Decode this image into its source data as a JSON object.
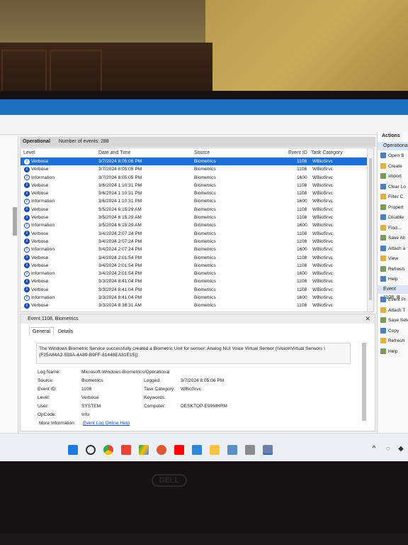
{
  "header": {
    "title": "Operational",
    "event_count": "Number of events: 288"
  },
  "columns": {
    "level": "Level",
    "date": "Date and Time",
    "source": "Source",
    "event_id": "Event ID",
    "task": "Task Category"
  },
  "rows": [
    {
      "level": "Verbose",
      "kind": "verbose",
      "date": "3/7/2024 8:05:06 PM",
      "source": "Biometrics",
      "id": "1108",
      "task": "WBioSrvc"
    },
    {
      "level": "Verbose",
      "kind": "verbose",
      "date": "3/7/2024 8:05:05 PM",
      "source": "Biometrics",
      "id": "1108",
      "task": "WBioSrvc"
    },
    {
      "level": "Information",
      "kind": "info",
      "date": "3/7/2024 8:05:05 PM",
      "source": "Biometrics",
      "id": "1600",
      "task": "WBioSrvc"
    },
    {
      "level": "Verbose",
      "kind": "verbose",
      "date": "3/6/2024 1:10:31 PM",
      "source": "Biometrics",
      "id": "1108",
      "task": "WBioSrvc"
    },
    {
      "level": "Verbose",
      "kind": "verbose",
      "date": "3/6/2024 1:10:31 PM",
      "source": "Biometrics",
      "id": "1108",
      "task": "WBioSrvc"
    },
    {
      "level": "Information",
      "kind": "info",
      "date": "3/6/2024 1:10:31 PM",
      "source": "Biometrics",
      "id": "1600",
      "task": "WBioSrvc"
    },
    {
      "level": "Verbose",
      "kind": "verbose",
      "date": "3/5/2024 6:15:29 AM",
      "source": "Biometrics",
      "id": "1108",
      "task": "WBioSrvc"
    },
    {
      "level": "Verbose",
      "kind": "verbose",
      "date": "3/5/2024 6:15:29 AM",
      "source": "Biometrics",
      "id": "1108",
      "task": "WBioSrvc"
    },
    {
      "level": "Information",
      "kind": "info",
      "date": "3/5/2024 6:15:29 AM",
      "source": "Biometrics",
      "id": "1600",
      "task": "WBioSrvc"
    },
    {
      "level": "Verbose",
      "kind": "verbose",
      "date": "3/4/2024 2:07:24 PM",
      "source": "Biometrics",
      "id": "1108",
      "task": "WBioSrvc"
    },
    {
      "level": "Verbose",
      "kind": "verbose",
      "date": "3/4/2024 2:07:24 PM",
      "source": "Biometrics",
      "id": "1108",
      "task": "WBioSrvc"
    },
    {
      "level": "Information",
      "kind": "info",
      "date": "3/4/2024 2:07:24 PM",
      "source": "Biometrics",
      "id": "1600",
      "task": "WBioSrvc"
    },
    {
      "level": "Verbose",
      "kind": "verbose",
      "date": "3/4/2024 2:01:54 PM",
      "source": "Biometrics",
      "id": "1108",
      "task": "WBioSrvc"
    },
    {
      "level": "Verbose",
      "kind": "verbose",
      "date": "3/4/2024 2:01:54 PM",
      "source": "Biometrics",
      "id": "1108",
      "task": "WBioSrvc"
    },
    {
      "level": "Information",
      "kind": "info",
      "date": "3/4/2024 2:01:54 PM",
      "source": "Biometrics",
      "id": "1600",
      "task": "WBioSrvc"
    },
    {
      "level": "Verbose",
      "kind": "verbose",
      "date": "3/3/2024 8:41:04 PM",
      "source": "Biometrics",
      "id": "1108",
      "task": "WBioSrvc"
    },
    {
      "level": "Verbose",
      "kind": "verbose",
      "date": "3/3/2024 8:41:04 PM",
      "source": "Biometrics",
      "id": "1108",
      "task": "WBioSrvc"
    },
    {
      "level": "Information",
      "kind": "info",
      "date": "3/3/2024 8:41:04 PM",
      "source": "Biometrics",
      "id": "1600",
      "task": "WBioSrvc"
    },
    {
      "level": "Verbose",
      "kind": "verbose",
      "date": "3/3/2024 8:38:31 AM",
      "source": "Biometrics",
      "id": "1108",
      "task": "WBioSrvc"
    }
  ],
  "detail": {
    "title": "Event 1108, Biometrics",
    "tab_general": "General",
    "tab_details": "Details",
    "description": "The Windows Biometric Service successfully created a Biometric Unit for sensor: Analog NUI Voice Virtual Sensor (\\Voice\\Virtual Sensors \\{F25A84A2-593A-4A89-B9FF-81448EA81E15})",
    "labels": {
      "log_name": "Log Name:",
      "source": "Source:",
      "event_id": "Event ID:",
      "level": "Level:",
      "user": "User:",
      "opcode": "OpCode:",
      "more_info": "More Information:",
      "logged": "Logged:",
      "task_category": "Task Category:",
      "keywords": "Keywords:",
      "computer": "Computer:"
    },
    "values": {
      "log_name": "Microsoft-Windows-Biometrics/Operational",
      "source": "Biometrics",
      "event_id": "1108",
      "level": "Verbose",
      "user": "SYSTEM",
      "opcode": "Info",
      "more_info": "Event Log Online Help",
      "logged": "3/7/2024 8:05:06 PM",
      "task_category": "WBioSrvc",
      "computer": "DESKTOP-E99MHRM"
    }
  },
  "actions": {
    "header": "Actions",
    "section1": "Operational",
    "items1": [
      "Open S",
      "Create",
      "Import",
      "Clear Lo",
      "Filter C",
      "Propert",
      "Disable",
      "Find...",
      "Save All",
      "Attach a",
      "View",
      "Refresh",
      "Help"
    ],
    "section2": "Event 1108, B",
    "items2": [
      "Event Pr",
      "Attach T",
      "Save Sele",
      "Copy",
      "Refresh",
      "Help"
    ]
  },
  "monitor": {
    "brand": "DELL"
  },
  "colors": {
    "selection": "#1d6fd8",
    "accent_blue": "#1e6fbf",
    "link": "#1a4fb5"
  },
  "taskbar_icons": [
    "windows-start-icon",
    "search-icon",
    "chrome-icon",
    "gmail-icon",
    "google-drive-icon",
    "duckduckgo-icon",
    "youtube-icon",
    "mail-icon",
    "file-explorer-icon",
    "remote-desktop-icon",
    "printer-icon",
    "event-viewer-icon"
  ]
}
